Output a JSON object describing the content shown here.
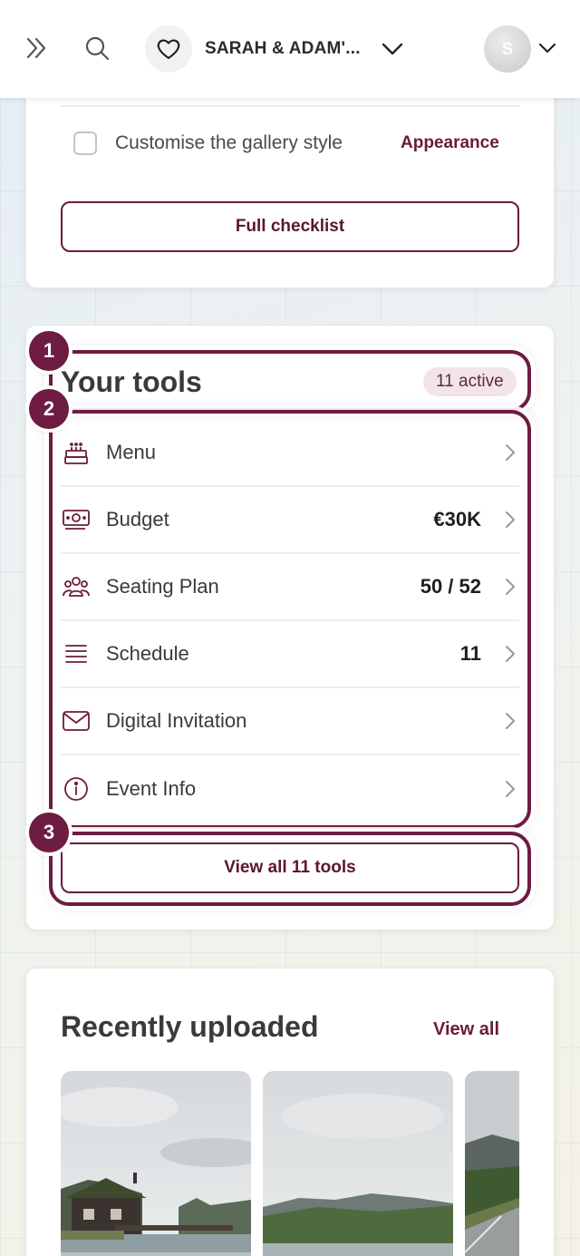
{
  "header": {
    "event_name": "SARAH & ADAM'...",
    "avatar_initial": "S",
    "icons": {
      "expand": "double-chevron-right-icon",
      "search": "search-icon",
      "event": "heart-icon",
      "event_dropdown": "chevron-down-icon",
      "avatar_dropdown": "chevron-down-icon"
    }
  },
  "checklist": {
    "items": [
      {
        "label": "Customise the gallery style",
        "action": "Appearance",
        "checked": false
      }
    ],
    "full_checklist_label": "Full checklist"
  },
  "tools": {
    "title": "Your tools",
    "active_badge": "11 active",
    "items": [
      {
        "label": "Menu",
        "value": "",
        "icon": "cake-icon"
      },
      {
        "label": "Budget",
        "value": "€30K",
        "icon": "money-icon"
      },
      {
        "label": "Seating Plan",
        "value": "50 / 52",
        "icon": "guests-icon"
      },
      {
        "label": "Schedule",
        "value": "11",
        "icon": "list-icon"
      },
      {
        "label": "Digital Invitation",
        "value": "",
        "icon": "envelope-icon"
      },
      {
        "label": "Event Info",
        "value": "",
        "icon": "info-icon"
      }
    ],
    "view_all_label": "View all 11 tools"
  },
  "annotations": [
    "1",
    "2",
    "3"
  ],
  "recent": {
    "title": "Recently uploaded",
    "view_all_label": "View all",
    "photos": [
      "lakeside-cabin-photo",
      "mountain-lake-photo",
      "mountain-road-photo"
    ]
  },
  "colors": {
    "accent": "#6b1b3c",
    "annotation": "#6e1c42",
    "badge_bg": "#f2e4e8"
  }
}
